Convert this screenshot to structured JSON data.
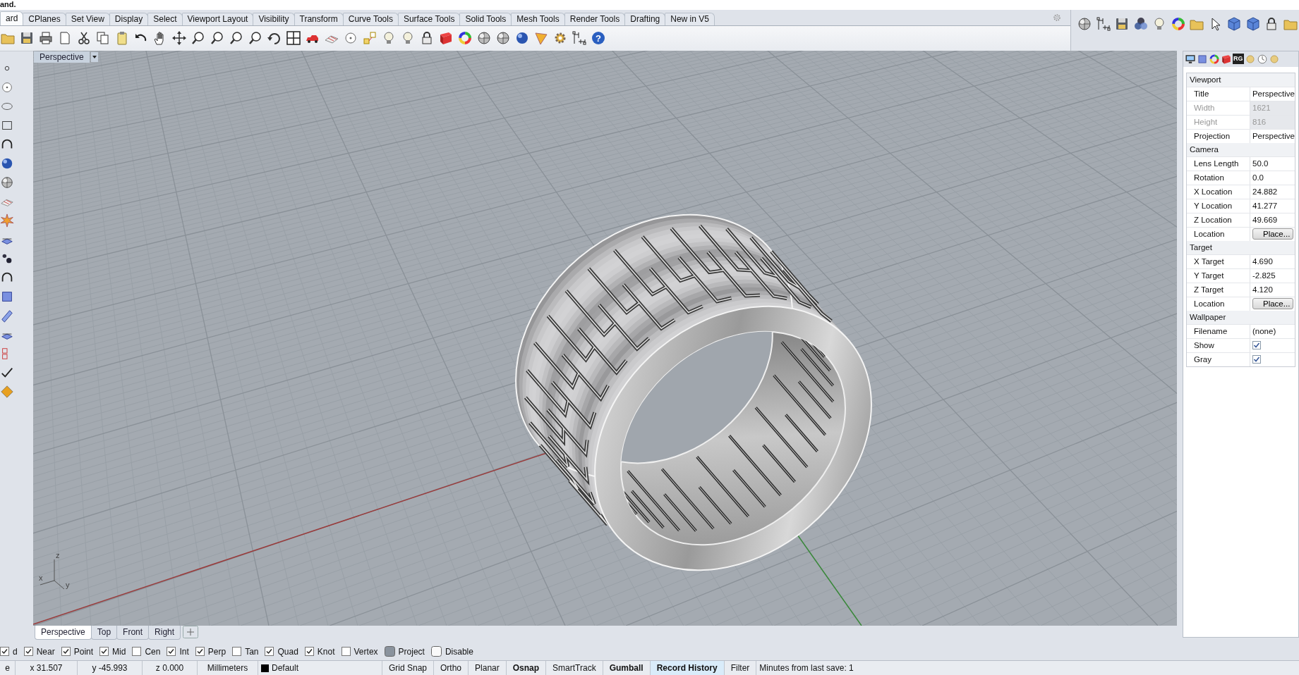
{
  "command_line": {
    "text": "and."
  },
  "toolbar_tabs": [
    {
      "label": "ard",
      "selected": true
    },
    {
      "label": "CPlanes",
      "selected": false
    },
    {
      "label": "Set View",
      "selected": false
    },
    {
      "label": "Display",
      "selected": false
    },
    {
      "label": "Select",
      "selected": false
    },
    {
      "label": "Viewport Layout",
      "selected": false
    },
    {
      "label": "Visibility",
      "selected": false
    },
    {
      "label": "Transform",
      "selected": false
    },
    {
      "label": "Curve Tools",
      "selected": false
    },
    {
      "label": "Surface Tools",
      "selected": false
    },
    {
      "label": "Solid Tools",
      "selected": false
    },
    {
      "label": "Mesh Tools",
      "selected": false
    },
    {
      "label": "Render Tools",
      "selected": false
    },
    {
      "label": "Drafting",
      "selected": false
    },
    {
      "label": "New in V5",
      "selected": false
    }
  ],
  "toolbar": {
    "help_glyph": "?"
  },
  "viewport": {
    "title": "Perspective",
    "gizmo_labels": [
      "z",
      "x",
      "y"
    ]
  },
  "viewport_tabs": [
    {
      "label": "Perspective",
      "selected": true
    },
    {
      "label": "Top",
      "selected": false
    },
    {
      "label": "Front",
      "selected": false
    },
    {
      "label": "Right",
      "selected": false
    }
  ],
  "panel_badge": "RG",
  "properties": [
    {
      "title": "Viewport",
      "rows": [
        {
          "label": "Title",
          "value": "Perspective",
          "kind": "text",
          "disabled": false
        },
        {
          "label": "Width",
          "value": "1621",
          "kind": "text",
          "disabled": true
        },
        {
          "label": "Height",
          "value": "816",
          "kind": "text",
          "disabled": true
        },
        {
          "label": "Projection",
          "value": "Perspective",
          "kind": "text",
          "disabled": false
        }
      ]
    },
    {
      "title": "Camera",
      "rows": [
        {
          "label": "Lens Length",
          "value": "50.0",
          "kind": "text",
          "disabled": false
        },
        {
          "label": "Rotation",
          "value": "0.0",
          "kind": "text",
          "disabled": false
        },
        {
          "label": "X Location",
          "value": "24.882",
          "kind": "text",
          "disabled": false
        },
        {
          "label": "Y Location",
          "value": "41.277",
          "kind": "text",
          "disabled": false
        },
        {
          "label": "Z Location",
          "value": "49.669",
          "kind": "text",
          "disabled": false
        },
        {
          "label": "Location",
          "value": "Place...",
          "kind": "button",
          "disabled": false
        }
      ]
    },
    {
      "title": "Target",
      "rows": [
        {
          "label": "X Target",
          "value": "4.690",
          "kind": "text",
          "disabled": false
        },
        {
          "label": "Y Target",
          "value": "-2.825",
          "kind": "text",
          "disabled": false
        },
        {
          "label": "Z Target",
          "value": "4.120",
          "kind": "text",
          "disabled": false
        },
        {
          "label": "Location",
          "value": "Place...",
          "kind": "button",
          "disabled": false
        }
      ]
    },
    {
      "title": "Wallpaper",
      "rows": [
        {
          "label": "Filename",
          "value": "(none)",
          "kind": "text",
          "disabled": false
        },
        {
          "label": "Show",
          "checked": true,
          "kind": "checkbox",
          "disabled": false
        },
        {
          "label": "Gray",
          "checked": true,
          "kind": "checkbox",
          "disabled": false
        }
      ]
    }
  ],
  "osnaps": [
    {
      "label": "d",
      "checked": true,
      "kind": "check"
    },
    {
      "label": "Near",
      "checked": true,
      "kind": "check"
    },
    {
      "label": "Point",
      "checked": true,
      "kind": "check"
    },
    {
      "label": "Mid",
      "checked": true,
      "kind": "check"
    },
    {
      "label": "Cen",
      "checked": false,
      "kind": "check"
    },
    {
      "label": "Int",
      "checked": true,
      "kind": "check"
    },
    {
      "label": "Perp",
      "checked": true,
      "kind": "check"
    },
    {
      "label": "Tan",
      "checked": false,
      "kind": "check"
    },
    {
      "label": "Quad",
      "checked": true,
      "kind": "check"
    },
    {
      "label": "Knot",
      "checked": true,
      "kind": "check"
    },
    {
      "label": "Vertex",
      "checked": false,
      "kind": "check"
    },
    {
      "label": "Project",
      "checked": true,
      "kind": "toggle"
    },
    {
      "label": "Disable",
      "checked": false,
      "kind": "toggle"
    }
  ],
  "status_bar": {
    "fields": [
      "e",
      "x 31.507",
      "y -45.993",
      "z 0.000",
      "Millimeters"
    ],
    "layer": {
      "name": "Default",
      "color": "#000000"
    },
    "panes": [
      {
        "label": "Grid Snap",
        "on": false,
        "highlighted": false
      },
      {
        "label": "Ortho",
        "on": false,
        "highlighted": false
      },
      {
        "label": "Planar",
        "on": false,
        "highlighted": false
      },
      {
        "label": "Osnap",
        "on": true,
        "highlighted": false
      },
      {
        "label": "SmartTrack",
        "on": false,
        "highlighted": false
      },
      {
        "label": "Gumball",
        "on": true,
        "highlighted": false
      },
      {
        "label": "Record History",
        "on": true,
        "highlighted": true
      },
      {
        "label": "Filter",
        "on": false,
        "highlighted": false
      }
    ],
    "message": "Minutes from last save: 1"
  }
}
